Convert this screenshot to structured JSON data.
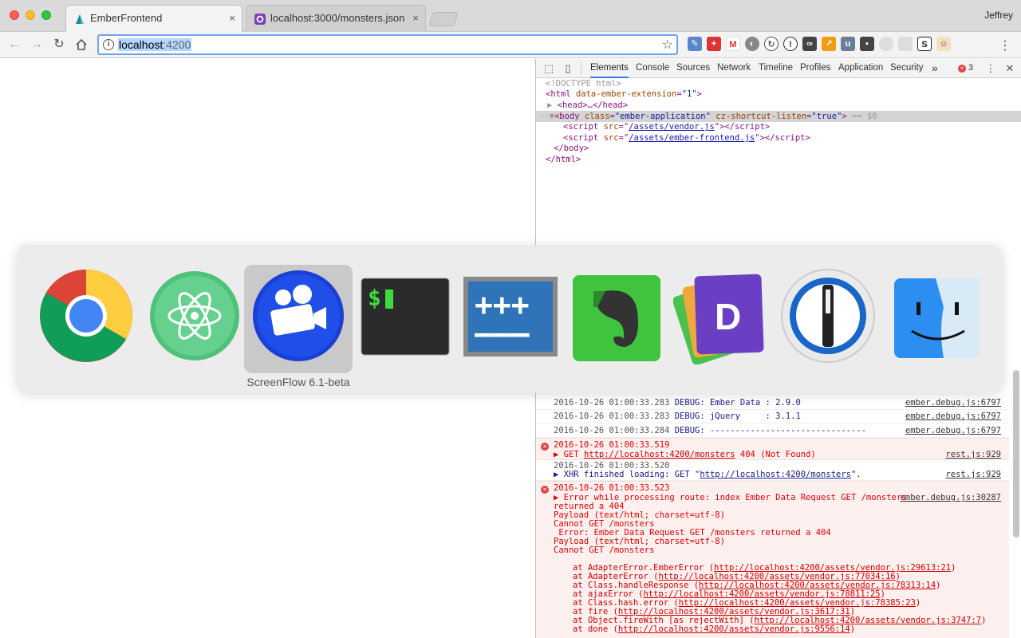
{
  "tabs": [
    {
      "title": "EmberFrontend",
      "close": "×"
    },
    {
      "title": "localhost:3000/monsters.json",
      "close": "×"
    }
  ],
  "profile_name": "Jeffrey",
  "address": {
    "host": "localhost",
    "port": ":4200"
  },
  "devtools": {
    "tabs": [
      "Elements",
      "Console",
      "Sources",
      "Network",
      "Timeline",
      "Profiles",
      "Application",
      "Security"
    ],
    "more": "»",
    "error_count": "3",
    "elements": {
      "doctype": "<!DOCTYPE html>",
      "html_open_tag": "<html ",
      "html_attr": "data-ember-extension",
      "html_val": "\"1\"",
      "head": "<head>…</head>",
      "body_tag": "<body ",
      "body_class_attr": "class",
      "body_class_val": "\"ember-application\"",
      "body_attr2": "cz-shortcut-listen",
      "body_attr2_val": "\"true\"",
      "body_suffix": " == $0",
      "script1_src": "/assets/vendor.js",
      "script2_src": "/assets/ember-frontend.js",
      "body_close": "</body>",
      "html_close": "</html>"
    },
    "console": {
      "debug1_ts": "2016-10-26 01:00:33.283",
      "debug1_msg": "DEBUG: Ember Data : 2.9.0",
      "debug1_src": "ember.debug.js:6797",
      "debug2_ts": "2016-10-26 01:00:33.283",
      "debug2_msg": "DEBUG: jQuery     : 3.1.1",
      "debug2_src": "ember.debug.js:6797",
      "debug3_ts": "2016-10-26 01:00:33.284",
      "debug3_msg": "DEBUG: -------------------------------",
      "debug3_src": "ember.debug.js:6797",
      "err1_ts": "2016-10-26 01:00:33.519",
      "err1_prefix": "▶ GET ",
      "err1_link": "http://localhost:4200/monsters",
      "err1_suffix": " 404 (Not Found)",
      "err1_src": "rest.js:929",
      "xhr_ts": "2016-10-26 01:00:33.520",
      "xhr_prefix": "▶ XHR finished loading: GET \"",
      "xhr_link": "http://localhost:4200/monsters",
      "xhr_suffix": "\".",
      "xhr_src": "rest.js:929",
      "err2_ts": "2016-10-26 01:00:33.523",
      "err2_src": "ember.debug.js:30287",
      "err2_lines": [
        "▶ Error while processing route: index Ember Data Request GET /monsters",
        "returned a 404",
        "Payload (text/html; charset=utf-8)",
        "Cannot GET /monsters",
        " Error: Ember Data Request GET /monsters returned a 404",
        "Payload (text/html; charset=utf-8)",
        "Cannot GET /monsters"
      ],
      "stack": [
        {
          "fn": "at AdapterError.EmberError (",
          "url": "http://localhost:4200/assets/vendor.js:29613:21",
          "end": ")"
        },
        {
          "fn": "at AdapterError (",
          "url": "http://localhost:4200/assets/vendor.js:77034:16",
          "end": ")"
        },
        {
          "fn": "at Class.handleResponse (",
          "url": "http://localhost:4200/assets/vendor.js:78313:14",
          "end": ")"
        },
        {
          "fn": "at ajaxError (",
          "url": "http://localhost:4200/assets/vendor.js:78811:25",
          "end": ")"
        },
        {
          "fn": "at Class.hash.error (",
          "url": "http://localhost:4200/assets/vendor.js:78385:23",
          "end": ")"
        },
        {
          "fn": "at fire (",
          "url": "http://localhost:4200/assets/vendor.js:3617:31",
          "end": ")"
        },
        {
          "fn": "at Object.fireWith [as rejectWith] (",
          "url": "http://localhost:4200/assets/vendor.js:3747:7",
          "end": ")"
        },
        {
          "fn": "at done (",
          "url": "http://localhost:4200/assets/vendor.js:9556:14",
          "end": ")"
        }
      ]
    }
  },
  "app_switcher": {
    "selected_label": "ScreenFlow 6.1-beta",
    "apps": [
      "chrome",
      "atom",
      "screenflow",
      "terminal",
      "diff",
      "evernote",
      "dash",
      "1password",
      "finder"
    ]
  },
  "colors": {
    "accent": "#3879d9",
    "error": "#e0443e",
    "selection": "#b4d5fe"
  }
}
